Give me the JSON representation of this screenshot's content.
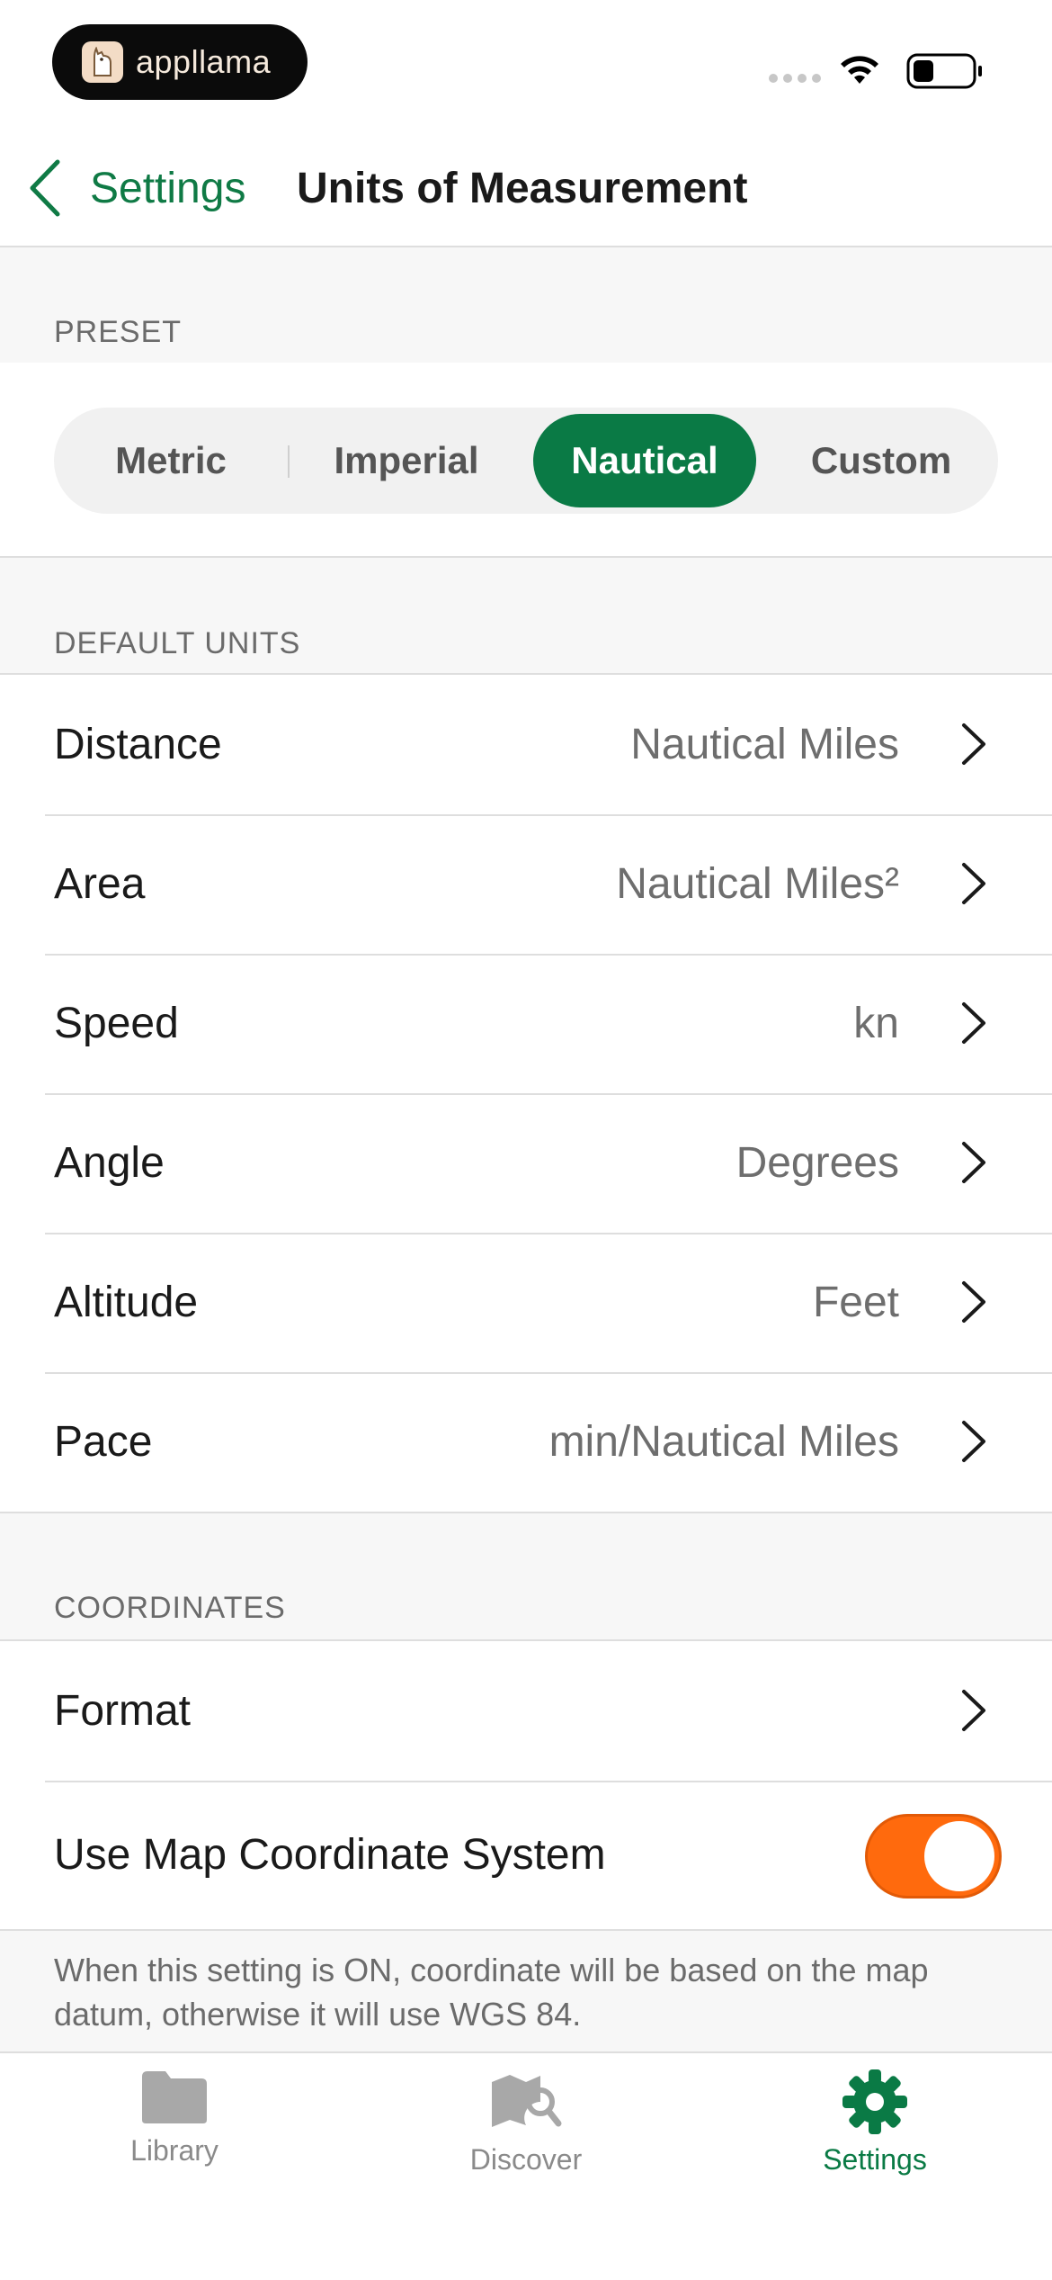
{
  "status_bar": {
    "brand": "appllama"
  },
  "nav": {
    "back_label": "Settings",
    "title": "Units of Measurement"
  },
  "sections": {
    "preset": "PRESET",
    "default_units": "DEFAULT UNITS",
    "coordinates": "COORDINATES"
  },
  "preset": {
    "options": [
      "Metric",
      "Imperial",
      "Nautical",
      "Custom"
    ],
    "selected": "Nautical"
  },
  "default_units": [
    {
      "label": "Distance",
      "value": "Nautical Miles"
    },
    {
      "label": "Area",
      "value": "Nautical Miles²"
    },
    {
      "label": "Speed",
      "value": "kn"
    },
    {
      "label": "Angle",
      "value": "Degrees"
    },
    {
      "label": "Altitude",
      "value": "Feet"
    },
    {
      "label": "Pace",
      "value": "min/Nautical Miles"
    }
  ],
  "coordinates": {
    "format_label": "Format",
    "map_system_label": "Use Map Coordinate System",
    "map_system_on": true,
    "footnote": "When this setting is ON, coordinate will be based on the map datum, otherwise it will use WGS 84."
  },
  "tabs": [
    {
      "label": "Library",
      "icon": "folder-icon"
    },
    {
      "label": "Discover",
      "icon": "map-search-icon"
    },
    {
      "label": "Settings",
      "icon": "gear-icon"
    }
  ],
  "colors": {
    "accent": "#0a7a45",
    "toggle_on": "#ff6a0d"
  }
}
